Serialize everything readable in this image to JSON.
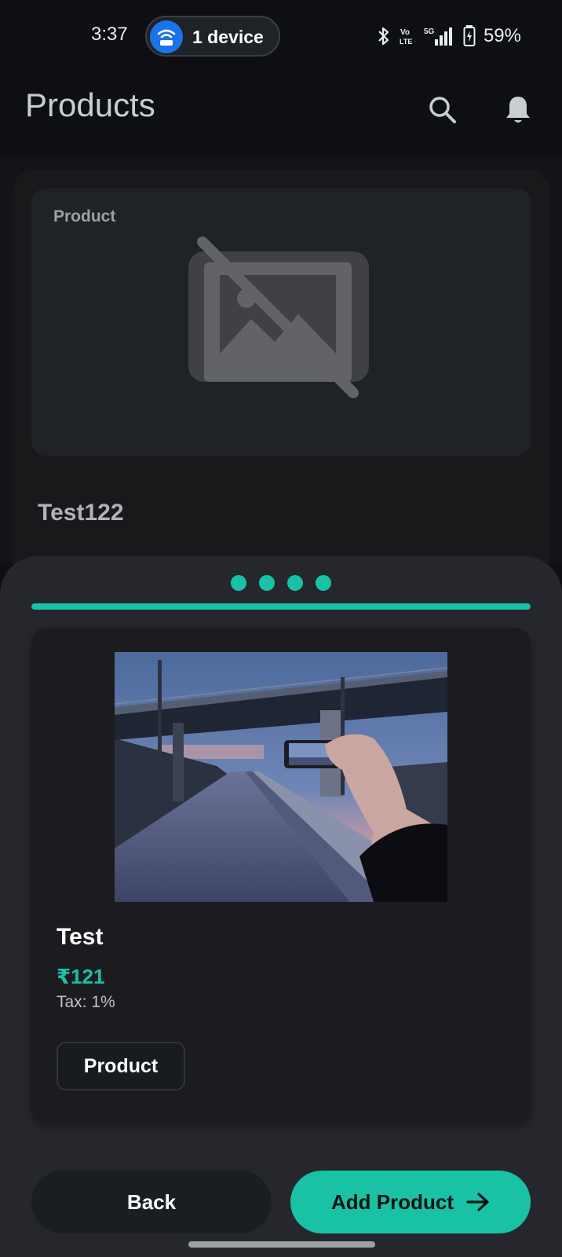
{
  "status_bar": {
    "time": "3:37",
    "hotspot_label": "1 device",
    "battery_percent": "59%",
    "icons": [
      "bluetooth-icon",
      "volte-icon",
      "5g-signal-icon",
      "battery-charging-icon"
    ]
  },
  "app_bar": {
    "title": "Products",
    "actions": [
      "search-icon",
      "bell-icon"
    ]
  },
  "background_card": {
    "image_label": "Product",
    "product_name": "Test122"
  },
  "sheet": {
    "step_count": 4,
    "progress_percent": 100,
    "preview": {
      "name": "Test",
      "price": "₹121",
      "tax": "Tax: 1%",
      "category": "Product"
    },
    "back_label": "Back",
    "add_label": "Add Product"
  },
  "colors": {
    "accent": "#19c2a5",
    "background": "#0d0f12",
    "sheet": "#26272c",
    "hotspot": "#1a73e8"
  }
}
